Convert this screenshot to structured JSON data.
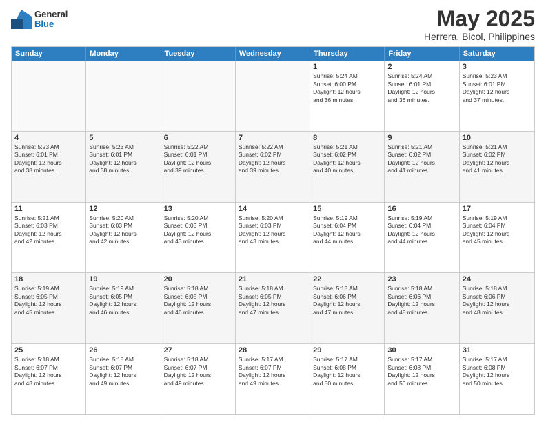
{
  "header": {
    "logo": {
      "general": "General",
      "blue": "Blue"
    },
    "title": "May 2025",
    "location": "Herrera, Bicol, Philippines"
  },
  "days_of_week": [
    "Sunday",
    "Monday",
    "Tuesday",
    "Wednesday",
    "Thursday",
    "Friday",
    "Saturday"
  ],
  "weeks": [
    [
      {
        "day": "",
        "empty": true,
        "lines": []
      },
      {
        "day": "",
        "empty": true,
        "lines": []
      },
      {
        "day": "",
        "empty": true,
        "lines": []
      },
      {
        "day": "",
        "empty": true,
        "lines": []
      },
      {
        "day": "1",
        "empty": false,
        "lines": [
          "Sunrise: 5:24 AM",
          "Sunset: 6:00 PM",
          "Daylight: 12 hours",
          "and 36 minutes."
        ]
      },
      {
        "day": "2",
        "empty": false,
        "lines": [
          "Sunrise: 5:24 AM",
          "Sunset: 6:01 PM",
          "Daylight: 12 hours",
          "and 36 minutes."
        ]
      },
      {
        "day": "3",
        "empty": false,
        "lines": [
          "Sunrise: 5:23 AM",
          "Sunset: 6:01 PM",
          "Daylight: 12 hours",
          "and 37 minutes."
        ]
      }
    ],
    [
      {
        "day": "4",
        "empty": false,
        "lines": [
          "Sunrise: 5:23 AM",
          "Sunset: 6:01 PM",
          "Daylight: 12 hours",
          "and 38 minutes."
        ]
      },
      {
        "day": "5",
        "empty": false,
        "lines": [
          "Sunrise: 5:23 AM",
          "Sunset: 6:01 PM",
          "Daylight: 12 hours",
          "and 38 minutes."
        ]
      },
      {
        "day": "6",
        "empty": false,
        "lines": [
          "Sunrise: 5:22 AM",
          "Sunset: 6:01 PM",
          "Daylight: 12 hours",
          "and 39 minutes."
        ]
      },
      {
        "day": "7",
        "empty": false,
        "lines": [
          "Sunrise: 5:22 AM",
          "Sunset: 6:02 PM",
          "Daylight: 12 hours",
          "and 39 minutes."
        ]
      },
      {
        "day": "8",
        "empty": false,
        "lines": [
          "Sunrise: 5:21 AM",
          "Sunset: 6:02 PM",
          "Daylight: 12 hours",
          "and 40 minutes."
        ]
      },
      {
        "day": "9",
        "empty": false,
        "lines": [
          "Sunrise: 5:21 AM",
          "Sunset: 6:02 PM",
          "Daylight: 12 hours",
          "and 41 minutes."
        ]
      },
      {
        "day": "10",
        "empty": false,
        "lines": [
          "Sunrise: 5:21 AM",
          "Sunset: 6:02 PM",
          "Daylight: 12 hours",
          "and 41 minutes."
        ]
      }
    ],
    [
      {
        "day": "11",
        "empty": false,
        "lines": [
          "Sunrise: 5:21 AM",
          "Sunset: 6:03 PM",
          "Daylight: 12 hours",
          "and 42 minutes."
        ]
      },
      {
        "day": "12",
        "empty": false,
        "lines": [
          "Sunrise: 5:20 AM",
          "Sunset: 6:03 PM",
          "Daylight: 12 hours",
          "and 42 minutes."
        ]
      },
      {
        "day": "13",
        "empty": false,
        "lines": [
          "Sunrise: 5:20 AM",
          "Sunset: 6:03 PM",
          "Daylight: 12 hours",
          "and 43 minutes."
        ]
      },
      {
        "day": "14",
        "empty": false,
        "lines": [
          "Sunrise: 5:20 AM",
          "Sunset: 6:03 PM",
          "Daylight: 12 hours",
          "and 43 minutes."
        ]
      },
      {
        "day": "15",
        "empty": false,
        "lines": [
          "Sunrise: 5:19 AM",
          "Sunset: 6:04 PM",
          "Daylight: 12 hours",
          "and 44 minutes."
        ]
      },
      {
        "day": "16",
        "empty": false,
        "lines": [
          "Sunrise: 5:19 AM",
          "Sunset: 6:04 PM",
          "Daylight: 12 hours",
          "and 44 minutes."
        ]
      },
      {
        "day": "17",
        "empty": false,
        "lines": [
          "Sunrise: 5:19 AM",
          "Sunset: 6:04 PM",
          "Daylight: 12 hours",
          "and 45 minutes."
        ]
      }
    ],
    [
      {
        "day": "18",
        "empty": false,
        "lines": [
          "Sunrise: 5:19 AM",
          "Sunset: 6:05 PM",
          "Daylight: 12 hours",
          "and 45 minutes."
        ]
      },
      {
        "day": "19",
        "empty": false,
        "lines": [
          "Sunrise: 5:19 AM",
          "Sunset: 6:05 PM",
          "Daylight: 12 hours",
          "and 46 minutes."
        ]
      },
      {
        "day": "20",
        "empty": false,
        "lines": [
          "Sunrise: 5:18 AM",
          "Sunset: 6:05 PM",
          "Daylight: 12 hours",
          "and 46 minutes."
        ]
      },
      {
        "day": "21",
        "empty": false,
        "lines": [
          "Sunrise: 5:18 AM",
          "Sunset: 6:05 PM",
          "Daylight: 12 hours",
          "and 47 minutes."
        ]
      },
      {
        "day": "22",
        "empty": false,
        "lines": [
          "Sunrise: 5:18 AM",
          "Sunset: 6:06 PM",
          "Daylight: 12 hours",
          "and 47 minutes."
        ]
      },
      {
        "day": "23",
        "empty": false,
        "lines": [
          "Sunrise: 5:18 AM",
          "Sunset: 6:06 PM",
          "Daylight: 12 hours",
          "and 48 minutes."
        ]
      },
      {
        "day": "24",
        "empty": false,
        "lines": [
          "Sunrise: 5:18 AM",
          "Sunset: 6:06 PM",
          "Daylight: 12 hours",
          "and 48 minutes."
        ]
      }
    ],
    [
      {
        "day": "25",
        "empty": false,
        "lines": [
          "Sunrise: 5:18 AM",
          "Sunset: 6:07 PM",
          "Daylight: 12 hours",
          "and 48 minutes."
        ]
      },
      {
        "day": "26",
        "empty": false,
        "lines": [
          "Sunrise: 5:18 AM",
          "Sunset: 6:07 PM",
          "Daylight: 12 hours",
          "and 49 minutes."
        ]
      },
      {
        "day": "27",
        "empty": false,
        "lines": [
          "Sunrise: 5:18 AM",
          "Sunset: 6:07 PM",
          "Daylight: 12 hours",
          "and 49 minutes."
        ]
      },
      {
        "day": "28",
        "empty": false,
        "lines": [
          "Sunrise: 5:17 AM",
          "Sunset: 6:07 PM",
          "Daylight: 12 hours",
          "and 49 minutes."
        ]
      },
      {
        "day": "29",
        "empty": false,
        "lines": [
          "Sunrise: 5:17 AM",
          "Sunset: 6:08 PM",
          "Daylight: 12 hours",
          "and 50 minutes."
        ]
      },
      {
        "day": "30",
        "empty": false,
        "lines": [
          "Sunrise: 5:17 AM",
          "Sunset: 6:08 PM",
          "Daylight: 12 hours",
          "and 50 minutes."
        ]
      },
      {
        "day": "31",
        "empty": false,
        "lines": [
          "Sunrise: 5:17 AM",
          "Sunset: 6:08 PM",
          "Daylight: 12 hours",
          "and 50 minutes."
        ]
      }
    ]
  ]
}
